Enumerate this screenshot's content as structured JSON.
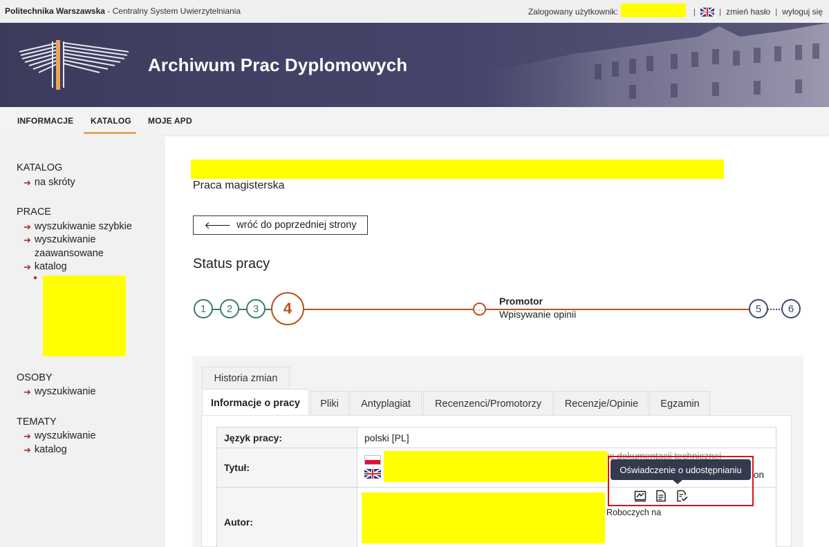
{
  "topbar": {
    "university": "Politechnika Warszawska",
    "system_name": " - Centralny System Uwierzytelniania",
    "logged_user_label": "Zalogowany użytkownik:",
    "change_password": "zmień hasło",
    "logout": "wyloguj się"
  },
  "banner": {
    "title": "Archiwum Prac Dyplomowych"
  },
  "nav": {
    "items": [
      {
        "label": "INFORMACJE"
      },
      {
        "label": "KATALOG"
      },
      {
        "label": "MOJE APD"
      }
    ],
    "active": "KATALOG"
  },
  "sidebar": {
    "catalog_head": "KATALOG",
    "catalog_shortcuts": "na skróty",
    "works_head": "PRACE",
    "works_quick": "wyszukiwanie szybkie",
    "works_advanced_1": "wyszukiwanie",
    "works_advanced_2": "zaawansowane",
    "works_catalog": "katalog",
    "people_head": "OSOBY",
    "people_search": "wyszukiwanie",
    "topics_head": "TEMATY",
    "topics_search": "wyszukiwanie",
    "topics_catalog": "katalog"
  },
  "main": {
    "subtitle": "Praca magisterska",
    "back_button": "wróć do poprzedniej strony",
    "status_heading": "Status pracy",
    "steps": [
      "1",
      "2",
      "3",
      "4",
      "5",
      "6"
    ],
    "substep": {
      "role": "Promotor",
      "description": "Wpisywanie opinii"
    }
  },
  "tabs": {
    "history": "Historia zmian",
    "items": [
      {
        "label": "Informacje o pracy"
      },
      {
        "label": "Pliki"
      },
      {
        "label": "Antyplagiat"
      },
      {
        "label": "Recenzenci/Promotorzy"
      },
      {
        "label": "Recenzje/Opinie"
      },
      {
        "label": "Egzamin"
      }
    ]
  },
  "info_table": {
    "language_label": "Język pracy:",
    "language_value": "polski [PL]",
    "title_label": "Tytuł:",
    "title_pl_tail": "ie dokumentacji technicznej",
    "title_en_tail": "on",
    "author_label": "Autor:",
    "author_tail": "Roboczych na"
  },
  "tooltip": {
    "text": "Oświadczenie o udostępnianiu"
  },
  "colors": {
    "banner": "#46446a",
    "accent_orange": "#b5541b",
    "done_green": "#3d7a66",
    "pending_navy": "#3e4a6a",
    "arrow_red": "#b2262c",
    "nav_active": "#e8a55c",
    "redaction": "#ffff00"
  }
}
